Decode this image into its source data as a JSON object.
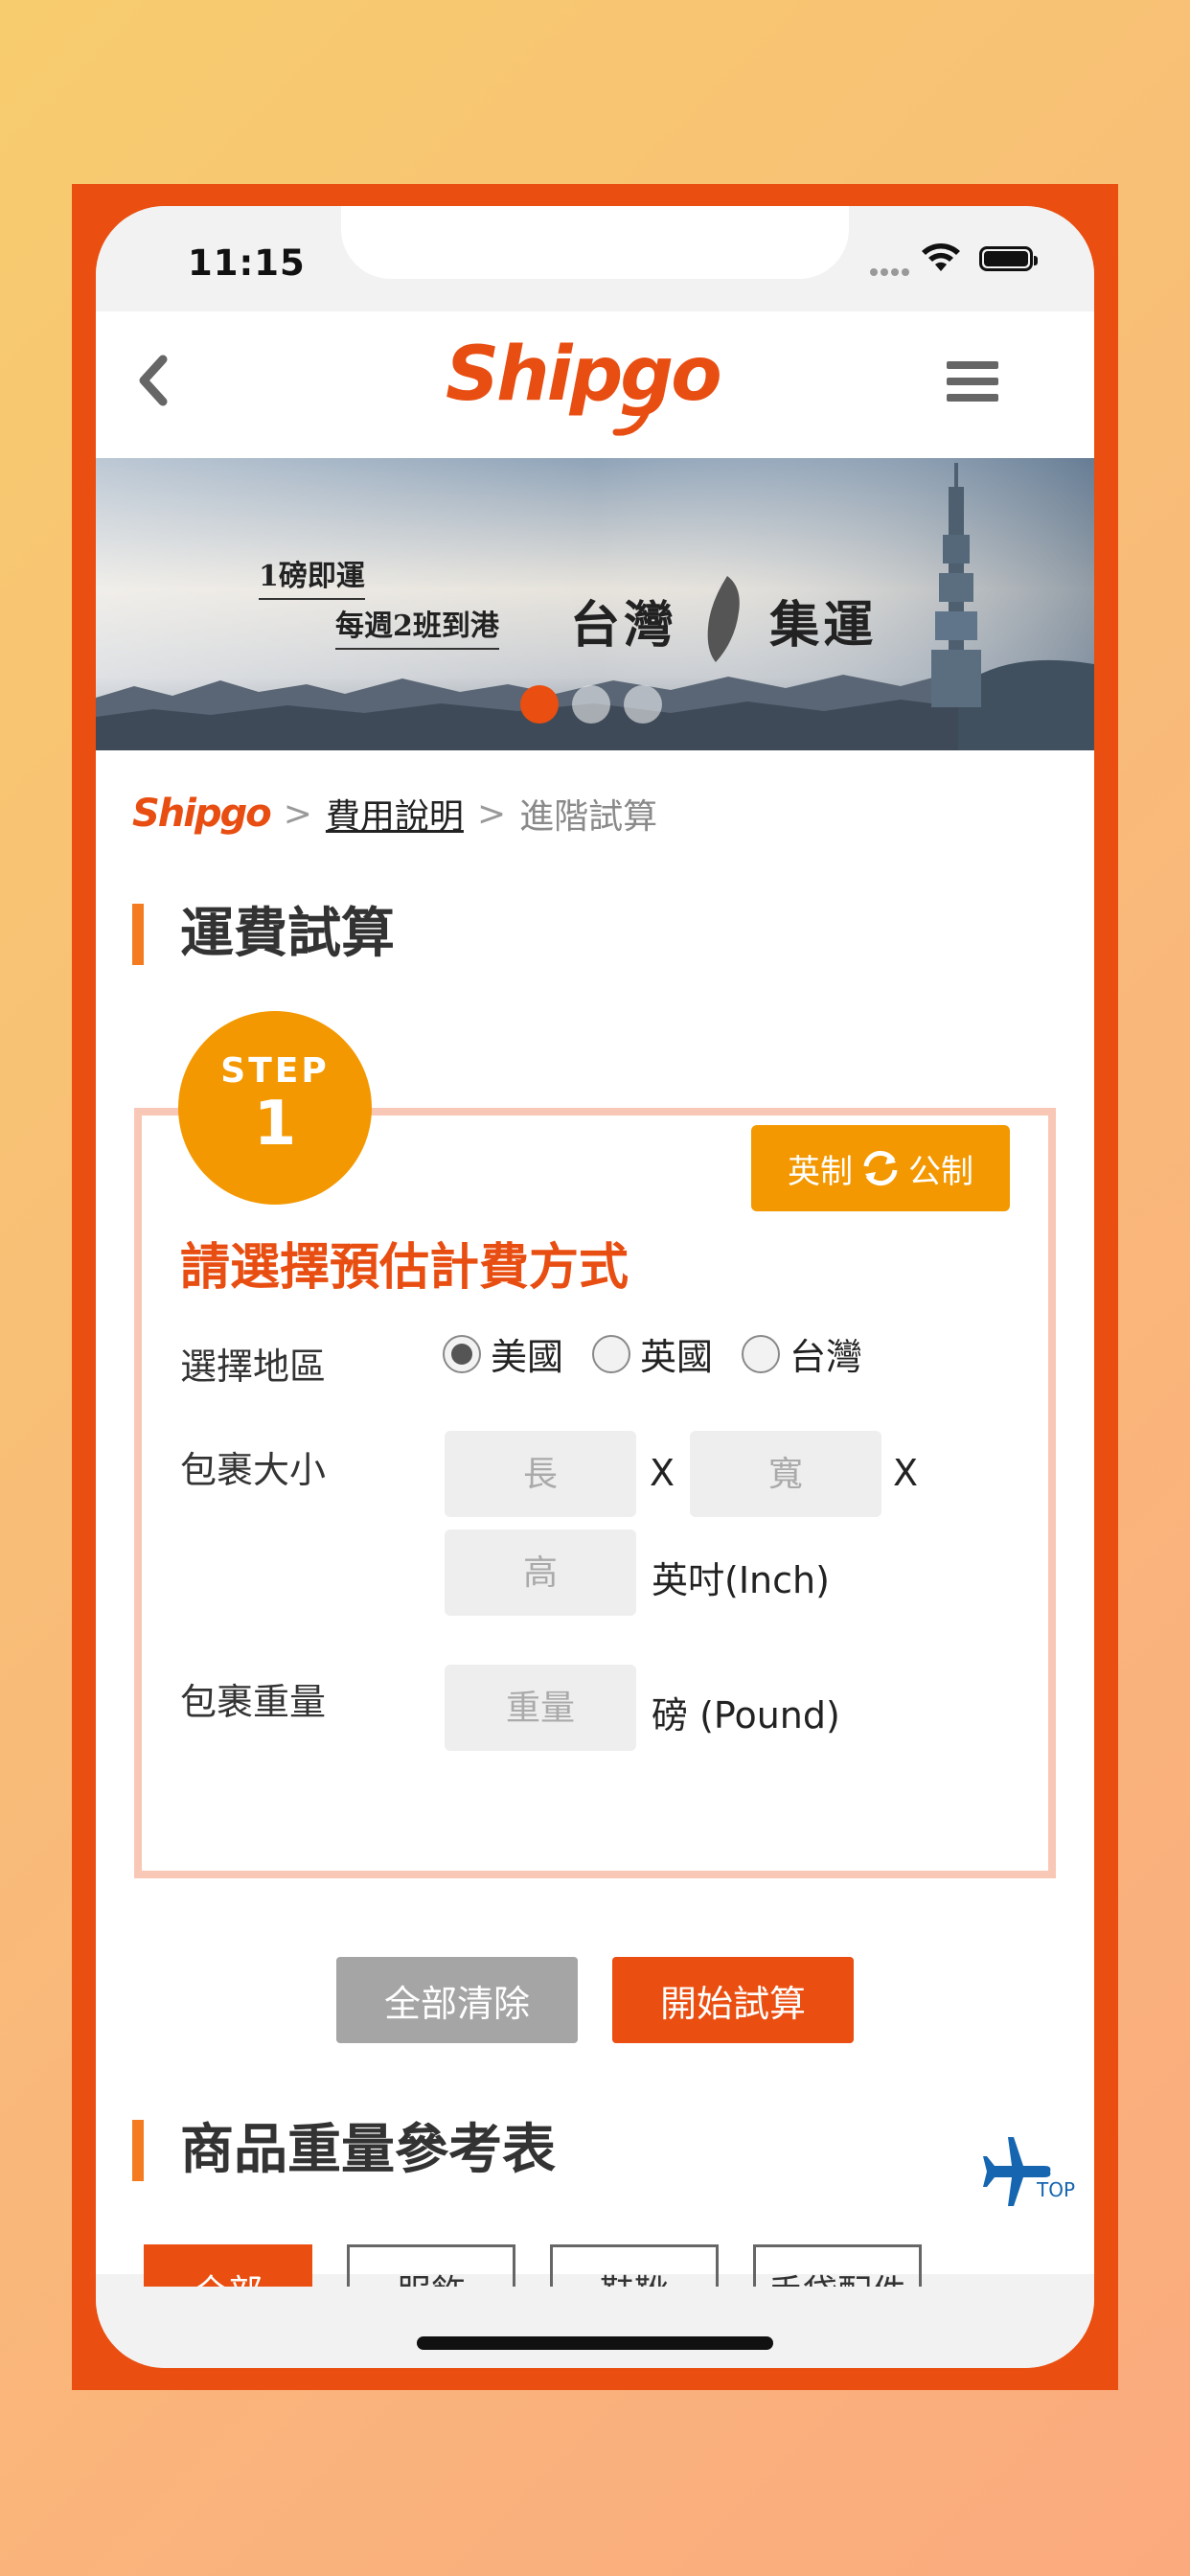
{
  "status": {
    "time": "11:15"
  },
  "header": {
    "logo": "Shipgo",
    "back": "back-icon",
    "menu": "menu-icon"
  },
  "banner": {
    "line1": "1磅即運",
    "line2": "每週2班到港",
    "headline": "台灣集運",
    "headline_left": "台灣",
    "headline_right": "集運",
    "slide_count": 3,
    "active_slide": 1
  },
  "breadcrumb": {
    "home": "Shipgo",
    "sep": ">",
    "link": "費用說明",
    "current": "進階試算"
  },
  "calculator": {
    "title": "運費試算",
    "step_label": "STEP",
    "step_number": "1",
    "unit_toggle": {
      "left": "英制",
      "right": "公制"
    },
    "form_title": "請選擇預估計費方式",
    "region": {
      "label": "選擇地區",
      "options": [
        "美國",
        "英國",
        "台灣"
      ],
      "selected": "美國"
    },
    "size": {
      "label": "包裹大小",
      "length_placeholder": "長",
      "width_placeholder": "寬",
      "height_placeholder": "高",
      "times": "X",
      "unit": "英吋(Inch)"
    },
    "weight": {
      "label": "包裹重量",
      "placeholder": "重量",
      "unit": "磅 (Pound)"
    },
    "buttons": {
      "clear": "全部清除",
      "calculate": "開始試算"
    }
  },
  "reference": {
    "title": "商品重量參考表",
    "tabs": [
      "全部",
      "服飾",
      "鞋靴",
      "手袋配件"
    ],
    "active_tab": "全部",
    "top_label": "TOP"
  },
  "colors": {
    "brand": "#ea4e10",
    "accent": "#f39800",
    "frame_border": "#f9c7b5"
  }
}
